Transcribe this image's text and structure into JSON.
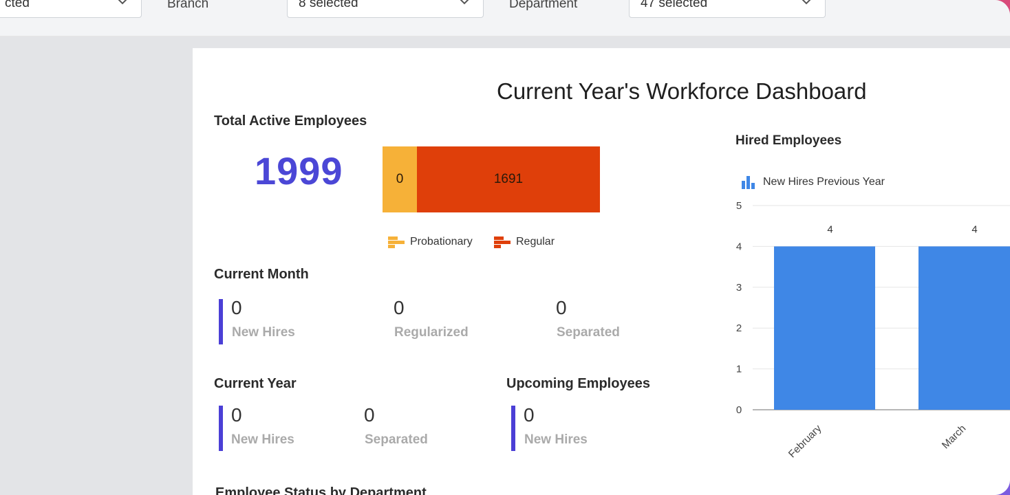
{
  "filters": {
    "first_select_value": "cted",
    "branch_label": "Branch",
    "branch_value": "8 selected",
    "department_label": "Department",
    "department_value": "47 selected"
  },
  "dashboard": {
    "title": "Current Year's Workforce Dashboard",
    "total_active": {
      "heading": "Total Active Employees",
      "count": "1999",
      "probationary_value": "0",
      "regular_value": "1691",
      "legend_probationary": "Probationary",
      "legend_regular": "Regular",
      "colors": {
        "probationary": "#f6b138",
        "regular": "#df3f0a"
      }
    },
    "current_month": {
      "heading": "Current Month",
      "new_hires_value": "0",
      "new_hires_label": "New Hires",
      "regularized_value": "0",
      "regularized_label": "Regularized",
      "separated_value": "0",
      "separated_label": "Separated"
    },
    "current_year": {
      "heading": "Current Year",
      "new_hires_value": "0",
      "new_hires_label": "New Hires",
      "separated_value": "0",
      "separated_label": "Separated"
    },
    "upcoming": {
      "heading": "Upcoming Employees",
      "new_hires_value": "0",
      "new_hires_label": "New Hires"
    },
    "next_section_heading": "Employee Status by Department"
  },
  "chart_data": {
    "type": "bar",
    "title": "Hired Employees",
    "categories": [
      "February",
      "March"
    ],
    "series": [
      {
        "name": "New Hires Previous Year",
        "values": [
          4,
          4
        ],
        "color": "#3f87e6"
      }
    ],
    "ylim": [
      0,
      5
    ],
    "yticks": [
      0,
      1,
      2,
      3,
      4,
      5
    ],
    "grid": true,
    "legend": "top-left"
  }
}
